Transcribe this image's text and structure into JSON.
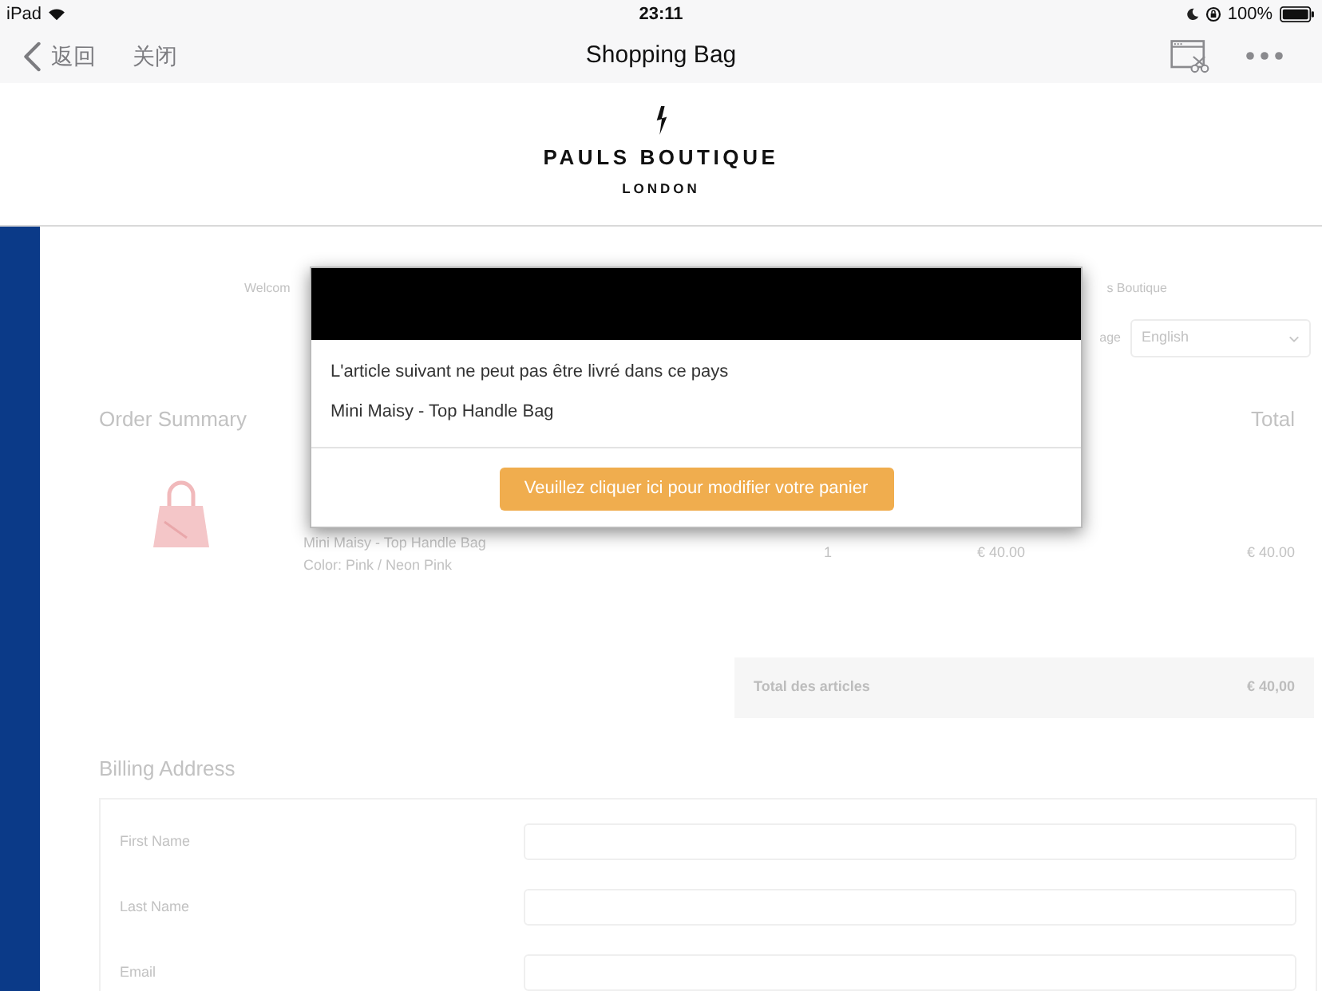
{
  "status_bar": {
    "device": "iPad",
    "time": "23:11",
    "battery": "100%"
  },
  "nav_bar": {
    "back": "返回",
    "close": "关闭",
    "title": "Shopping Bag"
  },
  "logo": {
    "name": "PAULS BOUTIQUE",
    "city": "LONDON"
  },
  "page": {
    "welcome": "Welcom",
    "store": "s Boutique",
    "language_label": "age",
    "language": "English",
    "order_summary": {
      "title": "Order Summary",
      "total_heading": "Total",
      "items": [
        {
          "name": "Mini Maisy - Top Handle Bag",
          "variant": "Color: Pink / Neon Pink",
          "quantity": "1",
          "price": "€ 40.00",
          "total": "€ 40.00"
        }
      ],
      "subtotal_label": "Total des articles",
      "subtotal": "€ 40,00"
    },
    "billing": {
      "title": "Billing Address",
      "fields": [
        {
          "label": "First Name"
        },
        {
          "label": "Last Name"
        },
        {
          "label": "Email"
        }
      ]
    }
  },
  "modal": {
    "message": "L'article suivant ne peut pas être livré dans ce pays",
    "item": "Mini Maisy - Top Handle Bag",
    "button": "Veuillez cliquer ici pour modifier votre panier"
  }
}
